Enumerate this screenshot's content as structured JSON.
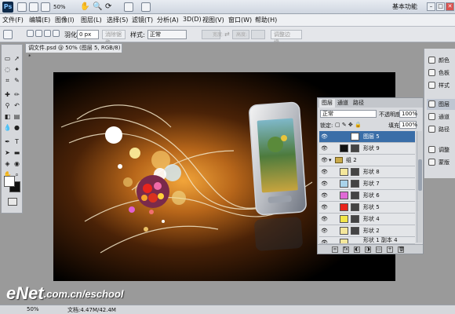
{
  "app": {
    "logo": "Ps",
    "zoom": "50%",
    "workspace": "基本功能",
    "win_min": "–",
    "win_max": "□",
    "win_close": "✕"
  },
  "menu": [
    "文件(F)",
    "编辑(E)",
    "图像(I)",
    "图层(L)",
    "选择(S)",
    "滤镜(T)",
    "分析(A)",
    "3D(D)",
    "视图(V)",
    "窗口(W)",
    "帮助(H)"
  ],
  "options": {
    "feather_label": "羽化:",
    "feather_value": "0 px",
    "antialias_label": "消除锯齿",
    "style_label": "样式:",
    "style_value": "正常",
    "width_label": "宽度:",
    "height_label": "高度:",
    "refine_label": "调整边缘..."
  },
  "document_tab": "调文件.psd @ 50% (图层 5, RGB/8) *",
  "right_panel": [
    {
      "label": "颜色",
      "icon": "color-icon"
    },
    {
      "label": "色板",
      "icon": "swatches-icon"
    },
    {
      "label": "样式",
      "icon": "styles-icon"
    },
    {
      "label": "图层",
      "icon": "layers-icon",
      "active": true
    },
    {
      "label": "通道",
      "icon": "channels-icon"
    },
    {
      "label": "路径",
      "icon": "paths-icon"
    },
    {
      "label": "调整",
      "icon": "adjust-icon"
    },
    {
      "label": "蒙版",
      "icon": "masks-icon"
    }
  ],
  "layers_panel": {
    "tabs": [
      "图层",
      "通道",
      "路径"
    ],
    "blend_mode": "正常",
    "opacity_label": "不透明度:",
    "opacity_value": "100%",
    "lock_label": "锁定:",
    "fill_label": "填充:",
    "fill_value": "100%",
    "layers": [
      {
        "name": "图层 5",
        "selected": true,
        "thumb": "#ffffff"
      },
      {
        "name": "形状 9",
        "thumb": "#111111"
      },
      {
        "name": "组 2",
        "group": true
      },
      {
        "name": "形状 8",
        "thumb": "#f4e79b"
      },
      {
        "name": "形状 7",
        "thumb": "#a9d3ea"
      },
      {
        "name": "形状 6",
        "thumb": "#e06ad6"
      },
      {
        "name": "形状 5",
        "thumb": "#e8241c"
      },
      {
        "name": "形状 4",
        "thumb": "#f2e64a"
      },
      {
        "name": "形状 2",
        "thumb": "#f4e79b"
      },
      {
        "name": "形状 1 副本 4",
        "thumb": "#f4e79b"
      }
    ]
  },
  "status": {
    "zoom": "50%",
    "doc": "文档:4.47M/42.4M"
  },
  "watermark": {
    "brand": "eNet",
    "url": ".com.cn/eschool"
  }
}
